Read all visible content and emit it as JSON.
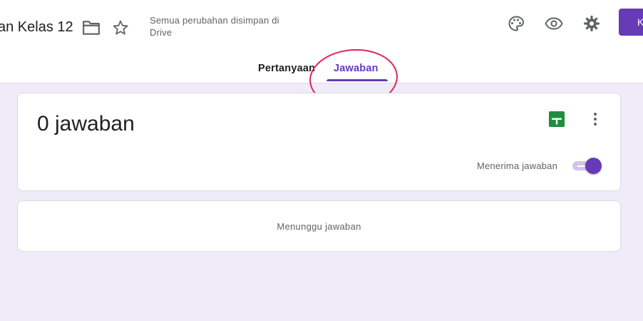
{
  "header": {
    "form_title": "an Kelas 12",
    "save_status": "Semua perubahan disimpan di Drive",
    "action_button_label": "K"
  },
  "tabs": [
    {
      "label": "Pertanyaan",
      "active": false
    },
    {
      "label": "Jawaban",
      "active": true
    }
  ],
  "summary": {
    "response_count": "0 jawaban",
    "accepting_label": "Menerima jawaban",
    "accepting_on": true
  },
  "waiting": {
    "message": "Menunggu jawaban"
  },
  "icons": {
    "folder": "folder-icon",
    "star": "star-icon",
    "palette": "palette-icon",
    "preview": "eye-icon",
    "settings": "gear-icon",
    "sheets": "sheets-icon",
    "more": "more-vert-icon"
  },
  "colors": {
    "accent": "#673ab7",
    "background": "#f0ebf8",
    "sheets_green": "#1e8e3e",
    "annotation": "#e0245e"
  }
}
